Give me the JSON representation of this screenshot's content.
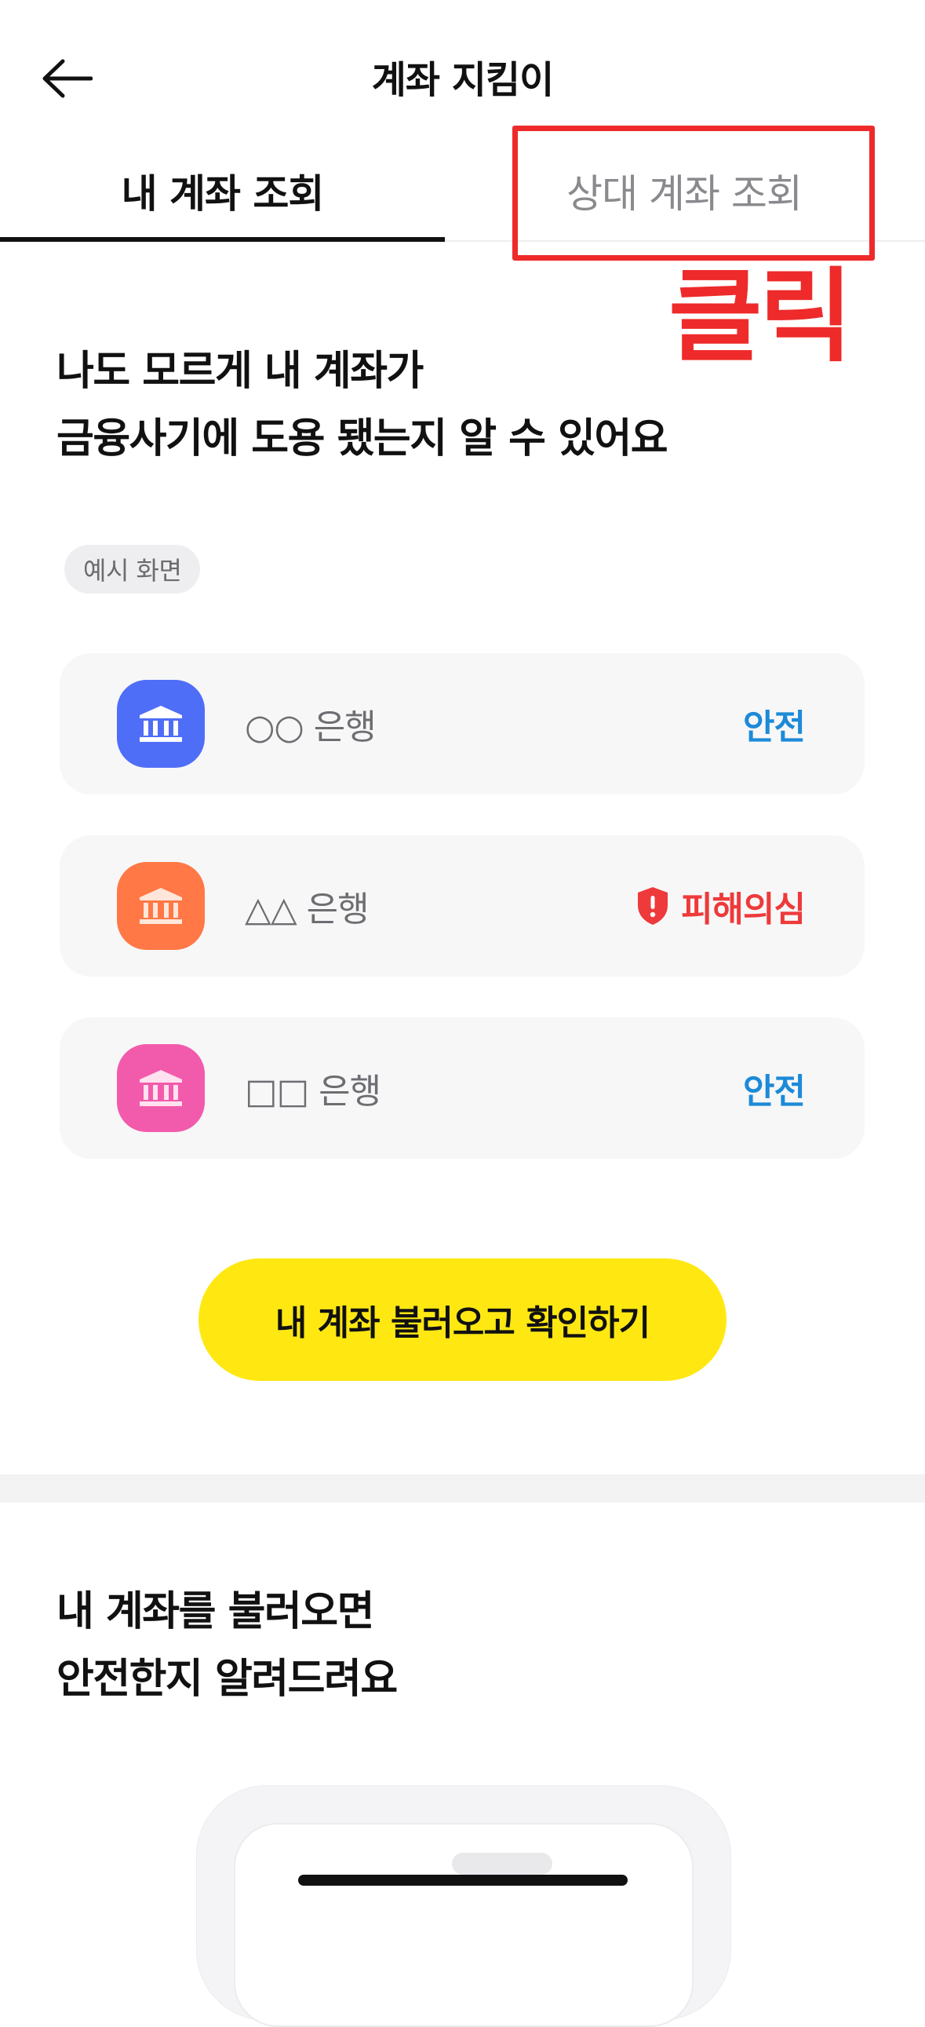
{
  "header": {
    "title": "계좌 지킴이",
    "back_icon": "arrow-left-icon"
  },
  "tabs": [
    {
      "label": "내 계좌 조회",
      "selected": true
    },
    {
      "label": "상대 계좌 조회",
      "selected": false
    }
  ],
  "annotation": {
    "label": "클릭",
    "color": "#ee2a2a"
  },
  "hero": {
    "line1": "나도 모르게 내 계좌가",
    "line2": "금융사기에 도용 됐는지 알 수 있어요"
  },
  "example_chip": "예시 화면",
  "banks": [
    {
      "name": "○○ 은행",
      "status": "안전",
      "status_type": "safe",
      "icon_color": "#4f6ef7",
      "icon": "bank-icon"
    },
    {
      "name": "△△ 은행",
      "status": "피해의심",
      "status_type": "risk",
      "icon_color": "#ff7845",
      "icon": "bank-icon",
      "status_icon": "shield-alert-icon"
    },
    {
      "name": "□□ 은행",
      "status": "안전",
      "status_type": "safe",
      "icon_color": "#f25bab",
      "icon": "bank-icon"
    }
  ],
  "cta": {
    "label": "내 계좌 불러오고 확인하기",
    "color": "#ffe812"
  },
  "section2": {
    "line1": "내 계좌를 불러오면",
    "line2": "안전한지 알려드려요"
  },
  "colors": {
    "safe": "#1c8ad8",
    "risk": "#ee3a3a"
  }
}
